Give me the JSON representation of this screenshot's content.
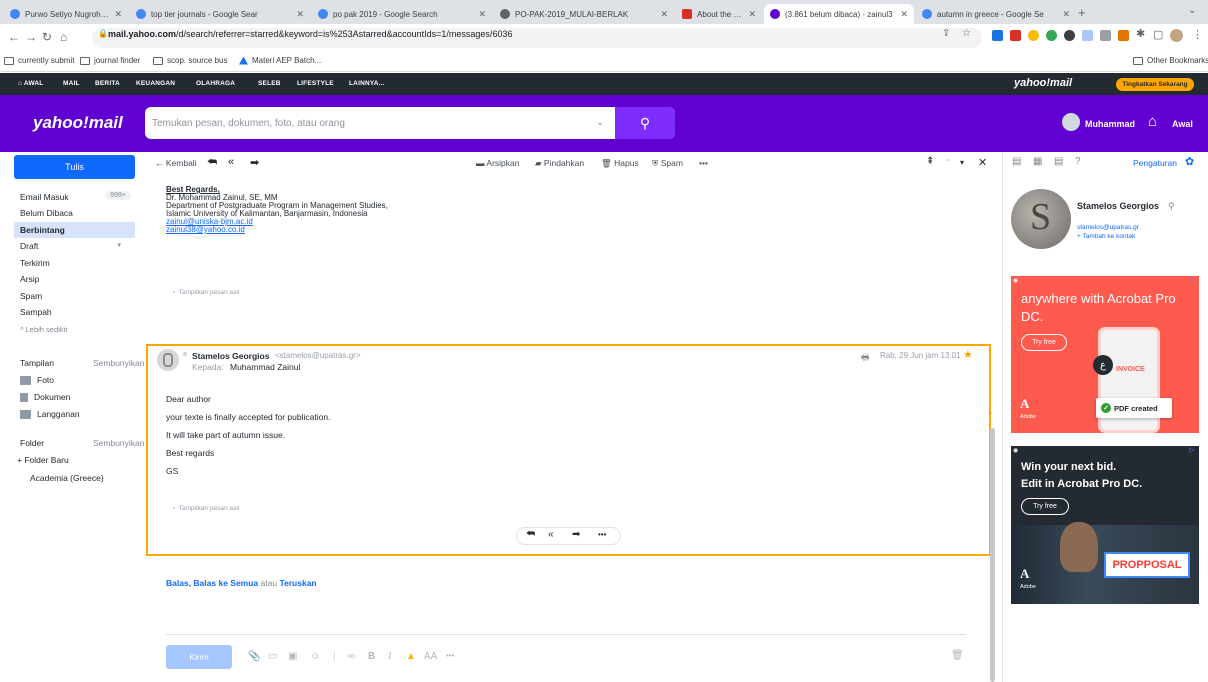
{
  "browser": {
    "tabs": [
      {
        "title": "Purwo Setiyo Nugroho - Googl",
        "color": "#4285f4"
      },
      {
        "title": "top tier journals - Google Sear",
        "color": "#4285f4"
      },
      {
        "title": "po pak 2019 - Google Search",
        "color": "#4285f4"
      },
      {
        "title": "PO-PAK-2019_MULAI-BERLAK",
        "color": "#5f6368"
      },
      {
        "title": "About the Journal",
        "color": "#d93025"
      },
      {
        "title": "(3.861 belum dibaca) - zainul3",
        "color": "#6001d2"
      },
      {
        "title": "autumn in greece - Google Se",
        "color": "#4285f4"
      }
    ],
    "url_host": "mail.yahoo.com",
    "url_path": "/d/search/referrer=starred&keyword=is%253Astarred&accountIds=1/messages/6036",
    "bookmarks": [
      "currently submit",
      "journal finder",
      "scop. source bus",
      "Materi AEP Batch..."
    ],
    "other_bookmarks": "Other Bookmarks"
  },
  "yahoo_nav": {
    "items": [
      "AWAL",
      "MAIL",
      "BERITA",
      "KEUANGAN",
      "OLAHRAGA",
      "SELEB",
      "LIFESTYLE",
      "LAINNYA..."
    ],
    "logo": "yahoo!mail",
    "upgrade": "Tingkatkan Sekarang"
  },
  "header": {
    "logo": "yahoo!mail",
    "search_placeholder": "Temukan pesan, dokumen, foto, atau orang",
    "user": "Muhammad",
    "home": "Awal"
  },
  "sidebar": {
    "compose": "Tulis",
    "folders": [
      {
        "label": "Email Masuk",
        "count": "999+"
      },
      {
        "label": "Belum Dibaca"
      },
      {
        "label": "Berbintang"
      },
      {
        "label": "Draft"
      },
      {
        "label": "Terkirim"
      },
      {
        "label": "Arsip"
      },
      {
        "label": "Spam"
      },
      {
        "label": "Sampah"
      }
    ],
    "less": "Lebih sedikit",
    "views_header": "Tampilan",
    "views_hide": "Sembunyikan",
    "views": [
      "Foto",
      "Dokumen",
      "Langganan"
    ],
    "folders_header": "Folder",
    "folders_hide": "Sembunyikan",
    "new_folder": "+ Folder Baru",
    "custom_folder": "Academia (Greece)"
  },
  "toolbar": {
    "back": "Kembali",
    "archive": "Arsipkan",
    "move": "Pindahkan",
    "delete": "Hapus",
    "spam": "Spam",
    "more": "•••"
  },
  "prev_message": {
    "lines": [
      "Best Regards,",
      "Dr. Mohammad Zainul, SE, MM",
      "Department of Postgraduate Program in Management Studies,",
      "Islamic University of Kalimantan, Banjarmasin, Indonesia",
      "zainul@uniska-bjm.ac.id",
      "zainul38@yahoo.co.id"
    ],
    "show_original": "Tampilkan pesan asli"
  },
  "message": {
    "from_name": "Stamelos Georgios",
    "from_addr": "<stamelos@upatras.gr>",
    "to_label": "Kepada:",
    "to_name": "Muhammad Zainul",
    "date": "Rab, 29 Jun jam 13.01",
    "body": [
      "Dear author",
      "your texte is finally accepted for publication.",
      "It will take part of autumn issue.",
      "Best regards",
      "GS"
    ],
    "show_original": "Tampilkan pesan asli",
    "more": "•••"
  },
  "reply_bar": {
    "reply": "Balas",
    "reply_all": "Balas ke Semua",
    "or": "atau",
    "forward": "Teruskan",
    "send": "Kirim",
    "more": "•••",
    "font_size": "AA"
  },
  "right_panel": {
    "settings": "Pengaturan",
    "contact_name": "Stamelos Georgios",
    "contact_email": "stamelos@upatras.gr",
    "add_contact": "+ Tambah ke kontak",
    "ad1_text": "anywhere with Acrobat Pro DC.",
    "ad1_button": "Try free",
    "ad1_invoice": "INVOICE",
    "ad1_pdf": "PDF created",
    "ad2_text_1": "Win your next bid.",
    "ad2_text_2": "Edit in Acrobat Pro DC.",
    "ad2_button": "Try free",
    "ad2_proposal": "PROPPOSAL",
    "ad_brand": "Adobe"
  },
  "colors": {
    "yahoo_purple": "#6001d2",
    "accent_blue": "#0f69ff",
    "highlight": "#ffa700"
  }
}
